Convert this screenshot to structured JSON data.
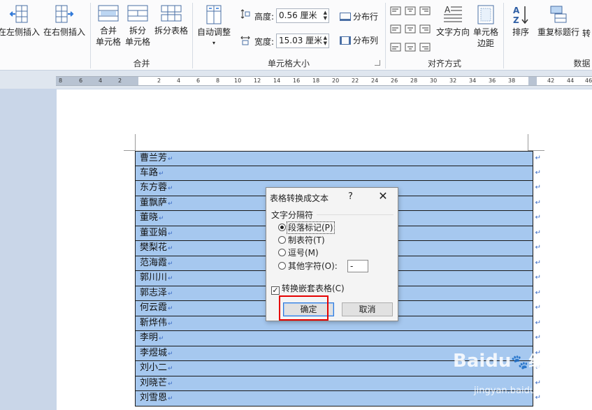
{
  "ribbon": {
    "buttons": {
      "insert_left": "在左侧插入",
      "insert_right": "在右侧插入",
      "merge_cells_line1": "合并",
      "merge_cells_line2": "单元格",
      "split_cells_line1": "拆分",
      "split_cells_line2": "单元格",
      "split_table": "拆分表格",
      "autofit": "自动调整",
      "autofit_arrow": "▾",
      "distribute_rows": "分布行",
      "distribute_cols": "分布列",
      "text_direction": "文字方向",
      "cell_margins_line1": "单元格",
      "cell_margins_line2": "边距",
      "sort": "排序",
      "repeat_header": "重复标题行",
      "convert_partial": "转"
    },
    "fields": {
      "height_label": "高度:",
      "height_value": "0.56 厘米",
      "width_label": "宽度:",
      "width_value": "15.03 厘米"
    },
    "groups": {
      "merge": "合并",
      "cell_size": "单元格大小",
      "alignment": "对齐方式",
      "data": "数据"
    }
  },
  "ruler": {
    "left_ticks": [
      "8",
      "6",
      "4",
      "2"
    ],
    "right_ticks": [
      "2",
      "4",
      "6",
      "8",
      "10",
      "12",
      "14",
      "16",
      "18",
      "20",
      "22",
      "24",
      "26",
      "28",
      "30",
      "32",
      "34",
      "36",
      "38"
    ],
    "tail_ticks": [
      "42",
      "44",
      "46"
    ]
  },
  "table": {
    "paragraph_mark": "↵",
    "rows": [
      "曹兰芳",
      "车路",
      "东方蓉",
      "董飘萨",
      "董晓",
      "董亚娟",
      "樊梨花",
      "范海霞",
      "郭川川",
      "郭志泽",
      "何云霞",
      "靳烨伟",
      "李明",
      "李煜城",
      "刘小二",
      "刘晓芒",
      "刘雪恩"
    ]
  },
  "dialog": {
    "title": "表格转换成文本",
    "help": "?",
    "close": "✕",
    "group_label": "文字分隔符",
    "options": {
      "paragraph": "段落标记(P)",
      "tab": "制表符(T)",
      "comma": "逗号(M)",
      "other": "其他字符(O):"
    },
    "other_value": "-",
    "convert_nested": "转换嵌套表格(C)",
    "checkmark": "✓",
    "ok": "确定",
    "cancel": "取消"
  },
  "watermark": {
    "brand": "Baidu",
    "brand_suffix": "经验",
    "url": "jingyan.baidu.com"
  },
  "colors": {
    "table_highlight": "#a6c8ef",
    "annotation_red": "#e60000",
    "ribbon_bg": "#fbfbfc"
  }
}
